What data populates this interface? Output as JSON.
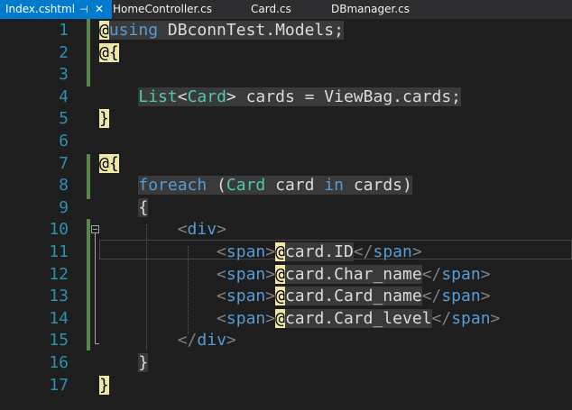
{
  "tabs": [
    {
      "label": "Index.cshtml",
      "active": true
    },
    {
      "label": "HomeController.cs",
      "active": false
    },
    {
      "label": "Card.cs",
      "active": false
    },
    {
      "label": "DBmanager.cs",
      "active": false
    }
  ],
  "icons": {
    "pin": "pin-icon",
    "close": "close-icon"
  },
  "colors": {
    "keyword": "#569cd6",
    "type": "#4ec9b0",
    "line_number": "#2b91af",
    "razor_highlight": "#ede8a9",
    "change_bar": "#57874b",
    "tab_active": "#007acc"
  },
  "lines": [
    {
      "n": "1",
      "tokens": [
        [
          "@",
          "razor"
        ],
        [
          "using",
          "kw cblk"
        ],
        [
          " DBconnTest.Models;",
          "txt cblk"
        ]
      ]
    },
    {
      "n": "2",
      "tokens": [
        [
          "@{",
          "razor"
        ]
      ]
    },
    {
      "n": "3",
      "tokens": []
    },
    {
      "n": "4",
      "tokens": [
        [
          "    ",
          "txt"
        ],
        [
          "List",
          "ty cblk"
        ],
        [
          "<",
          "txt cblk"
        ],
        [
          "Card",
          "ty cblk"
        ],
        [
          "> cards = ViewBag.cards;",
          "txt cblk"
        ]
      ]
    },
    {
      "n": "5",
      "tokens": [
        [
          "}",
          "razor"
        ]
      ]
    },
    {
      "n": "6",
      "tokens": []
    },
    {
      "n": "7",
      "tokens": [
        [
          "@{",
          "razor"
        ]
      ]
    },
    {
      "n": "8",
      "tokens": [
        [
          "    ",
          "txt"
        ],
        [
          "foreach",
          "kw cblk"
        ],
        [
          " (",
          "txt cblk"
        ],
        [
          "Card",
          "ty cblk"
        ],
        [
          " card ",
          "txt cblk"
        ],
        [
          "in",
          "kw cblk"
        ],
        [
          " cards)",
          "txt cblk"
        ]
      ]
    },
    {
      "n": "9",
      "tokens": [
        [
          "    ",
          "txt"
        ],
        [
          "{",
          "txt cblk"
        ]
      ]
    },
    {
      "n": "10",
      "tokens": [
        [
          "        ",
          "txt"
        ],
        [
          "<",
          "ang"
        ],
        [
          "div",
          "tag"
        ],
        [
          ">",
          "ang"
        ]
      ]
    },
    {
      "n": "11",
      "tokens": [
        [
          "            ",
          "txt"
        ],
        [
          "<",
          "ang"
        ],
        [
          "span",
          "tag"
        ],
        [
          ">",
          "ang"
        ],
        [
          "@",
          "razor"
        ],
        [
          "card.ID",
          "txt cblk"
        ],
        [
          "</",
          "ang"
        ],
        [
          "span",
          "tag"
        ],
        [
          ">",
          "ang"
        ]
      ]
    },
    {
      "n": "12",
      "tokens": [
        [
          "            ",
          "txt"
        ],
        [
          "<",
          "ang"
        ],
        [
          "span",
          "tag"
        ],
        [
          ">",
          "ang"
        ],
        [
          "@",
          "razor"
        ],
        [
          "card.Char_name",
          "txt cblk"
        ],
        [
          "</",
          "ang"
        ],
        [
          "span",
          "tag"
        ],
        [
          ">",
          "ang"
        ]
      ]
    },
    {
      "n": "13",
      "tokens": [
        [
          "            ",
          "txt"
        ],
        [
          "<",
          "ang"
        ],
        [
          "span",
          "tag"
        ],
        [
          ">",
          "ang"
        ],
        [
          "@",
          "razor"
        ],
        [
          "card.Card_name",
          "txt cblk"
        ],
        [
          "</",
          "ang"
        ],
        [
          "span",
          "tag"
        ],
        [
          ">",
          "ang"
        ]
      ]
    },
    {
      "n": "14",
      "tokens": [
        [
          "            ",
          "txt"
        ],
        [
          "<",
          "ang"
        ],
        [
          "span",
          "tag"
        ],
        [
          ">",
          "ang"
        ],
        [
          "@",
          "razor"
        ],
        [
          "card.Card_level",
          "txt cblk"
        ],
        [
          "</",
          "ang"
        ],
        [
          "span",
          "tag"
        ],
        [
          ">",
          "ang"
        ]
      ]
    },
    {
      "n": "15",
      "tokens": [
        [
          "        ",
          "txt"
        ],
        [
          "</",
          "ang"
        ],
        [
          "div",
          "tag"
        ],
        [
          ">",
          "ang"
        ]
      ]
    },
    {
      "n": "16",
      "tokens": [
        [
          "    ",
          "txt"
        ],
        [
          "}",
          "txt cblk"
        ]
      ]
    },
    {
      "n": "17",
      "tokens": [
        [
          "}",
          "razor"
        ]
      ]
    }
  ]
}
